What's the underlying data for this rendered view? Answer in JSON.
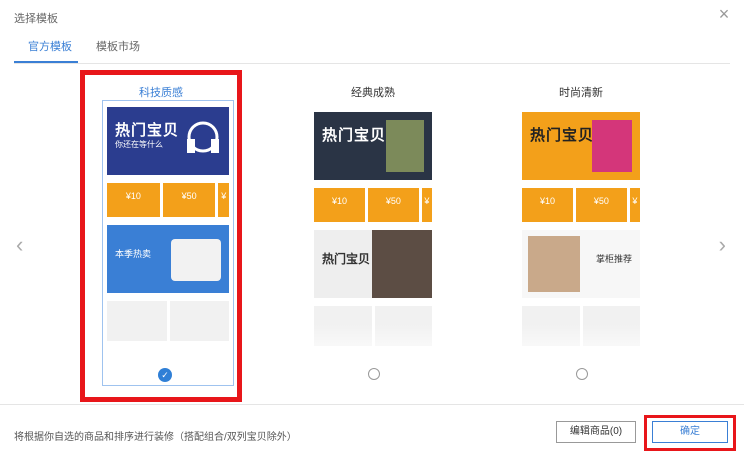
{
  "dialog": {
    "title": "选择模板",
    "close_glyph": "×"
  },
  "tabs": [
    {
      "label": "官方模板",
      "active": true
    },
    {
      "label": "模板市场",
      "active": false
    }
  ],
  "nav": {
    "prev_glyph": "‹",
    "next_glyph": "›"
  },
  "templates": [
    {
      "label": "科技质感",
      "selected": true,
      "banner_title": "热门宝贝",
      "banner_sub": "你还在等什么",
      "coupons": [
        "¥10",
        "¥50",
        "¥"
      ],
      "block_title": "本季热卖",
      "accent": "#2b3d8f"
    },
    {
      "label": "经典成熟",
      "selected": false,
      "banner_title": "热门宝贝",
      "banner_sub": "",
      "coupons": [
        "¥10",
        "¥50",
        "¥"
      ],
      "block_title": "热门宝贝",
      "accent": "#2a3445"
    },
    {
      "label": "时尚清新",
      "selected": false,
      "banner_title": "热门宝贝",
      "banner_sub": "",
      "coupons": [
        "¥10",
        "¥50",
        "¥"
      ],
      "block_title": "掌柜推荐",
      "accent": "#f3a01a"
    }
  ],
  "footer": {
    "note": "将根据你自选的商品和排序进行装修（搭配组合/双列宝贝除外）",
    "edit_label": "编辑商品(0)",
    "confirm_label": "确定"
  },
  "colors": {
    "primary": "#3a7fd5",
    "highlight_red": "#e8161a",
    "coupon_orange": "#f3a01a"
  }
}
